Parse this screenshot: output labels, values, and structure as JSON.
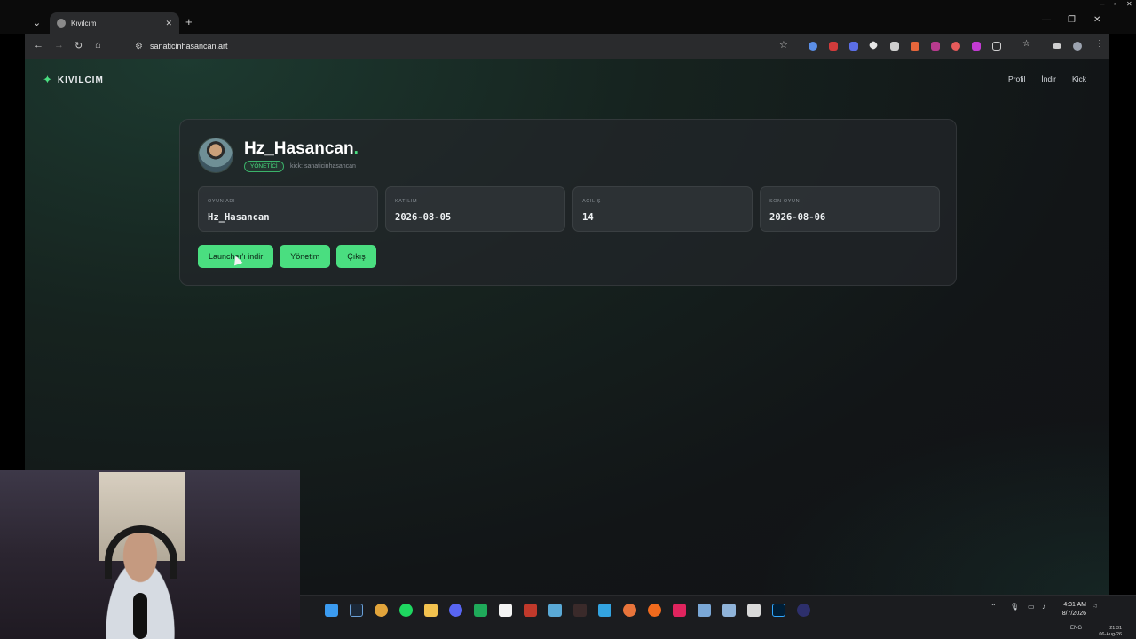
{
  "browser": {
    "tab_title": "Kıvılcım",
    "tab_close": "✕",
    "new_tab": "+",
    "url": "sanaticinhasancan.art"
  },
  "site": {
    "brand": "KIVILCIM",
    "nav": [
      {
        "label": "Profil"
      },
      {
        "label": "İndir"
      },
      {
        "label": "Kick"
      }
    ]
  },
  "profile": {
    "username": "Hz_Hasancan",
    "username_dot": ".",
    "role_badge": "YÖNETİCİ",
    "kick_handle": "kick: sanaticinhasancan",
    "stats": [
      {
        "label": "OYUN ADI",
        "value": "Hz_Hasancan"
      },
      {
        "label": "KATILIM",
        "value": "2026-08-05"
      },
      {
        "label": "AÇILIŞ",
        "value": "14"
      },
      {
        "label": "SON OYUN",
        "value": "2026-08-06"
      }
    ],
    "buttons": {
      "launcher": "Launcher'ı indir",
      "admin": "Yönetim",
      "logout": "Çıkış"
    }
  },
  "taskbar": {
    "time": "4:31 AM",
    "date": "8/7/2026",
    "lang": "ENG",
    "secondary_time": "21:31",
    "secondary_date": "06-Aug-26"
  },
  "colors": {
    "accent": "#4ade80",
    "card_bg": "#22262a",
    "page_bg": "#121517"
  }
}
